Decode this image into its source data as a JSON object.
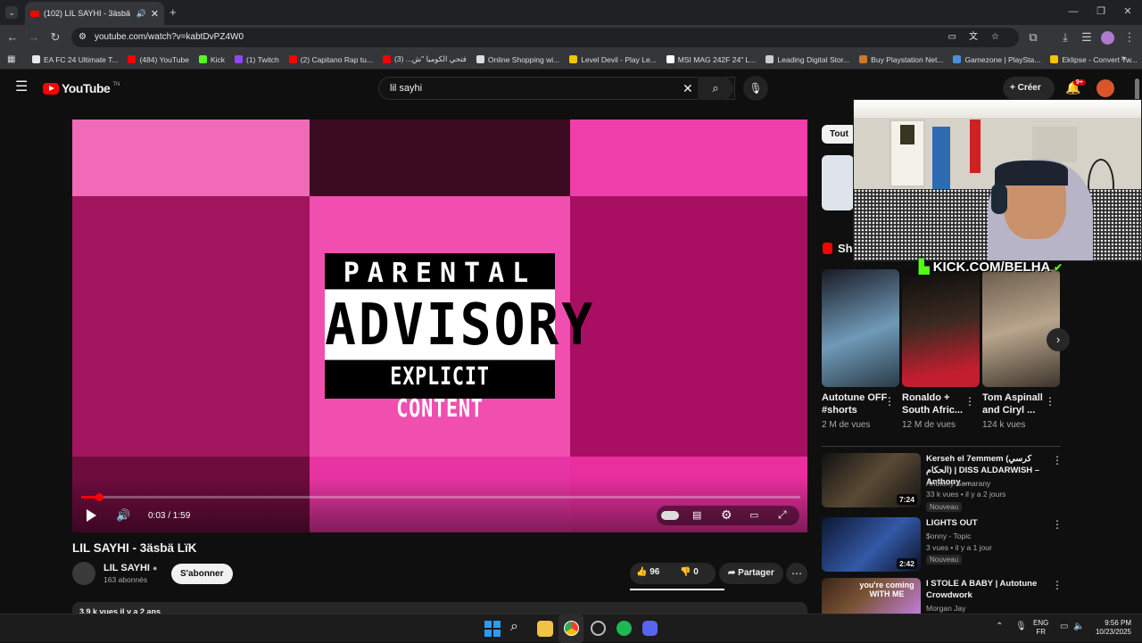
{
  "browser": {
    "tab_title": "(102) LIL SAYHI - 3äsbä LïK",
    "url": "youtube.com/watch?v=kabtDvPZ4W0",
    "bookmarks": [
      {
        "label": "EA FC 24 Ultimate T...",
        "color": "#e8e8e8"
      },
      {
        "label": "(484) YouTube",
        "color": "#ff0000"
      },
      {
        "label": "Kick",
        "color": "#53fc18"
      },
      {
        "label": "(1) Twitch",
        "color": "#9146ff"
      },
      {
        "label": "(2) Capitano Rap tu...",
        "color": "#ff0000"
      },
      {
        "label": "فتحي الكوميا \"ش... (3)",
        "color": "#ff0000"
      },
      {
        "label": "Online Shopping wi...",
        "color": "#dddddd"
      },
      {
        "label": "Level Devil - Play Le...",
        "color": "#f5c400"
      },
      {
        "label": "MSI MAG 242F 24\" L...",
        "color": "#ffffff"
      },
      {
        "label": "Leading Digital Stor...",
        "color": "#cccccc"
      },
      {
        "label": "Buy Playstation Net...",
        "color": "#c77b2b"
      },
      {
        "label": "Gamezone | PlaySta...",
        "color": "#4a90d9"
      },
      {
        "label": "Eklipse - Convert Tw...",
        "color": "#f5c400"
      }
    ]
  },
  "youtube": {
    "logo": "YouTube",
    "logo_region": "TN",
    "search_value": "lil sayhi",
    "create_label": "Créer",
    "notif_count": "9+",
    "chip_label": "Tout",
    "shorts_label": "Shorts",
    "kick_overlay": "KICK.COM/BELHA"
  },
  "player": {
    "advisory_line1": "PARENTAL",
    "advisory_line2": "ADVISORY",
    "advisory_line3": "EXPLICIT CONTENT",
    "time": "0:03 / 1:59",
    "progress": 0.025,
    "volume": 0.6
  },
  "video": {
    "title": "LIL SAYHI - 3äsbä LïK",
    "channel": "LIL SAYHI",
    "subscribers": "163 abonnés",
    "subscribe_label": "S'abonner",
    "likes": "96",
    "dislikes": "0",
    "share_label": "Partager",
    "description_meta": "3,9 k vues  il y a 2 ans"
  },
  "shorts": [
    {
      "title": "Autotune OFF #shorts",
      "views": "2 M de vues"
    },
    {
      "title": "Ronaldo + South Afric...",
      "views": "12 M de vues"
    },
    {
      "title": "Tom Aspinall and Ciryl ...",
      "views": "124 k vues"
    }
  ],
  "recommendations": [
    {
      "title": "Kersеh el 7emmem (كرسي الحكام) | DISS ALDARWISH – Anthony ...",
      "channel": "Anthony Samarany",
      "meta": "33 k vues • il y a 2 jours",
      "badge": "Nouveau",
      "duration": "7:24"
    },
    {
      "title": "LIGHTS OUT",
      "channel": "$onny - Topic",
      "meta": "3 vues • il y a 1 jour",
      "badge": "Nouveau",
      "duration": "2:42"
    },
    {
      "title": "I STOLE A BABY | Autotune Crowdwork",
      "channel": "Morgan Jay",
      "meta": "",
      "badge": "",
      "duration": "",
      "thumb_text": "you're coming WITH ME"
    }
  ],
  "taskbar": {
    "lang1": "ENG",
    "lang2": "FR",
    "time": "9:56 PM",
    "date": "10/23/2025"
  }
}
